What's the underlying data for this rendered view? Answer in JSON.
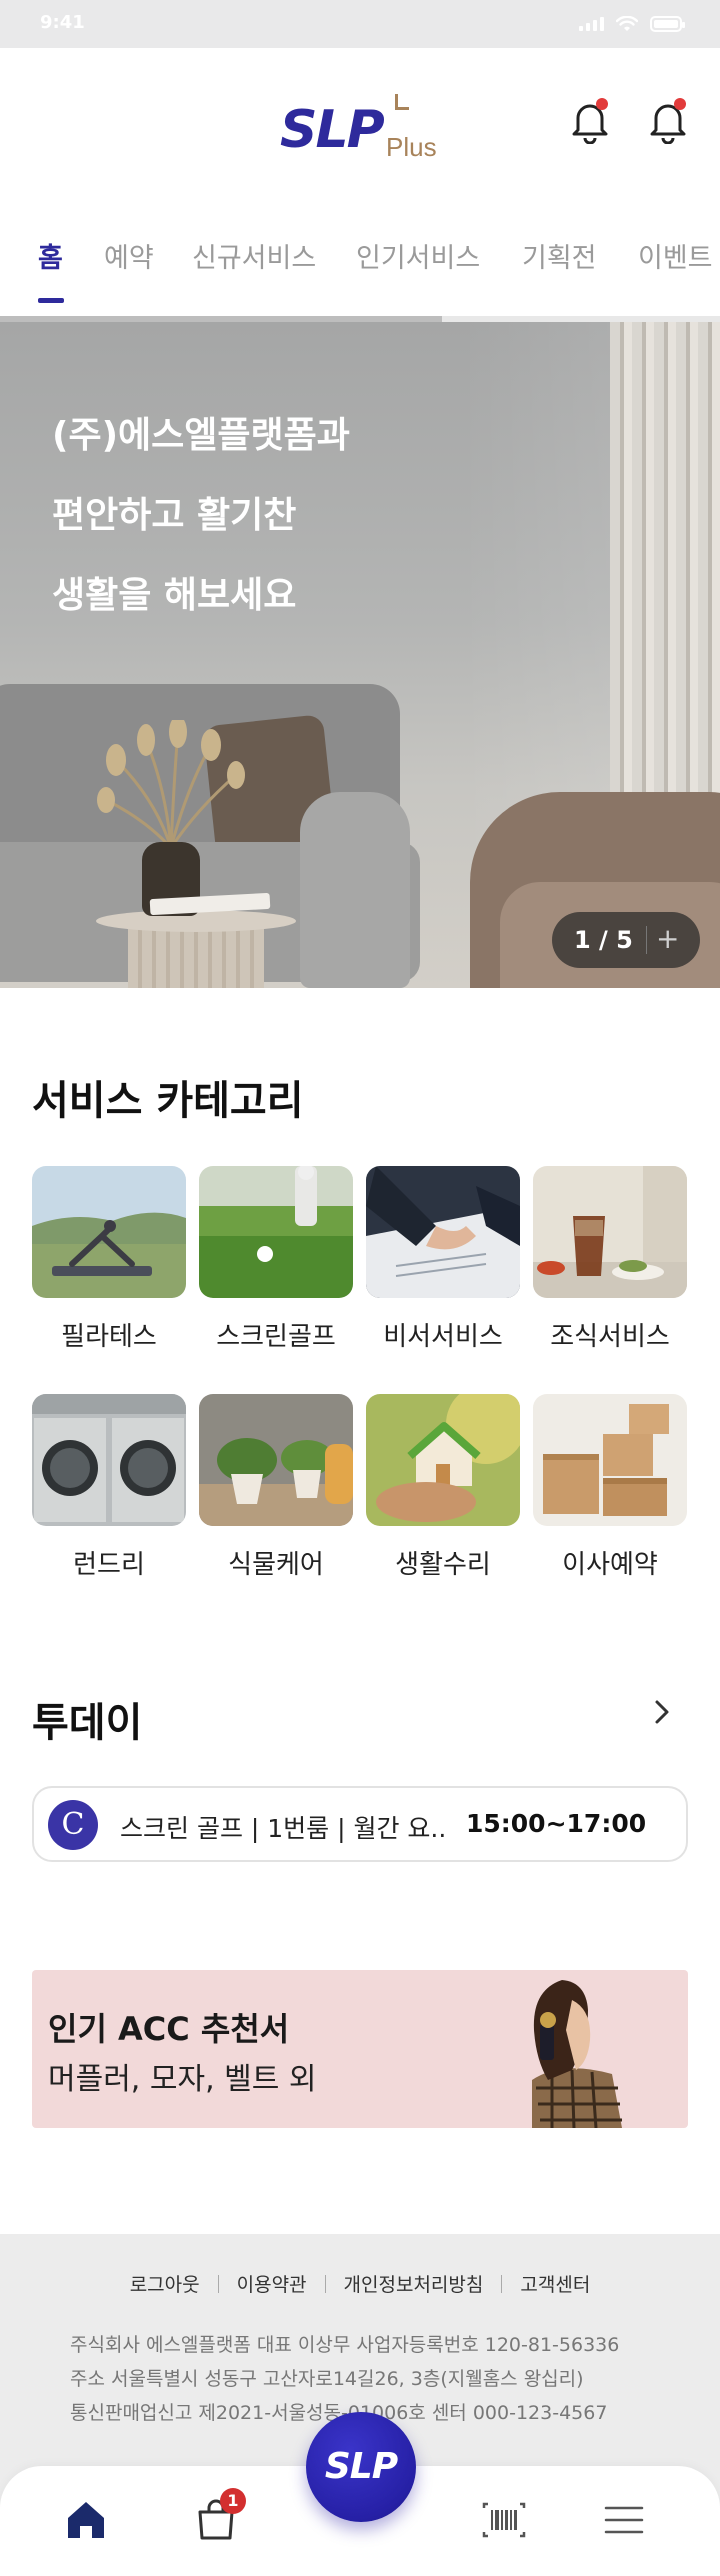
{
  "status_bar": {
    "time": "9:41"
  },
  "header": {
    "logo_main": "SLP",
    "logo_sub": "Plus",
    "icons": [
      "bell-icon",
      "bell-icon"
    ]
  },
  "tabs": [
    {
      "label": "홈",
      "active": true
    },
    {
      "label": "예약",
      "active": false
    },
    {
      "label": "신규서비스",
      "active": false
    },
    {
      "label": "인기서비스",
      "active": false
    },
    {
      "label": "기획전",
      "active": false
    },
    {
      "label": "이벤트",
      "active": false
    }
  ],
  "hero": {
    "lines": [
      "(주)에스엘플랫폼과",
      "편안하고 활기찬",
      "생활을 해보세요"
    ],
    "pager": "1 / 5",
    "pager_action": "+"
  },
  "categories": {
    "title": "서비스 카테고리",
    "items": [
      {
        "label": "필라테스",
        "icon": "pilates-photo"
      },
      {
        "label": "스크린골프",
        "icon": "golf-photo"
      },
      {
        "label": "비서서비스",
        "icon": "secretary-photo"
      },
      {
        "label": "조식서비스",
        "icon": "breakfast-photo"
      },
      {
        "label": "런드리",
        "icon": "laundry-photo"
      },
      {
        "label": "식물케어",
        "icon": "plant-photo"
      },
      {
        "label": "생활수리",
        "icon": "repair-photo"
      },
      {
        "label": "이사예약",
        "icon": "moving-photo"
      }
    ]
  },
  "today": {
    "title": "투데이",
    "card": {
      "badge": "C",
      "title": "스크린 골프 | 1번룸 | 월간 요..",
      "time": "15:00~17:00"
    }
  },
  "banner": {
    "title": "인기 ACC 추천서",
    "subtitle": "머플러, 모자, 벨트 외"
  },
  "footer": {
    "links": [
      "로그아웃",
      "이용약관",
      "개인정보처리방침",
      "고객센터"
    ],
    "info": [
      "주식회사 에스엘플랫폼    대표  이상무    사업자등록번호  120-81-56336",
      "주소  서울특별시 성동구 고산자로14길26, 3층(지웰홈스 왕십리)",
      "통신판매업신고  제2021-서울성동-01006호     센터  000-123-4567"
    ]
  },
  "bottom_nav": {
    "fab_label": "SLP",
    "cart_count": "1",
    "items": [
      "home-icon",
      "cart-icon",
      "barcode-icon",
      "menu-icon"
    ]
  },
  "colors": {
    "brand": "#2e2a9c",
    "brand_accent": "#a8835a",
    "badge_red": "#e23b3b",
    "banner_bg": "#f2d9d9",
    "footer_bg": "#ececec"
  }
}
